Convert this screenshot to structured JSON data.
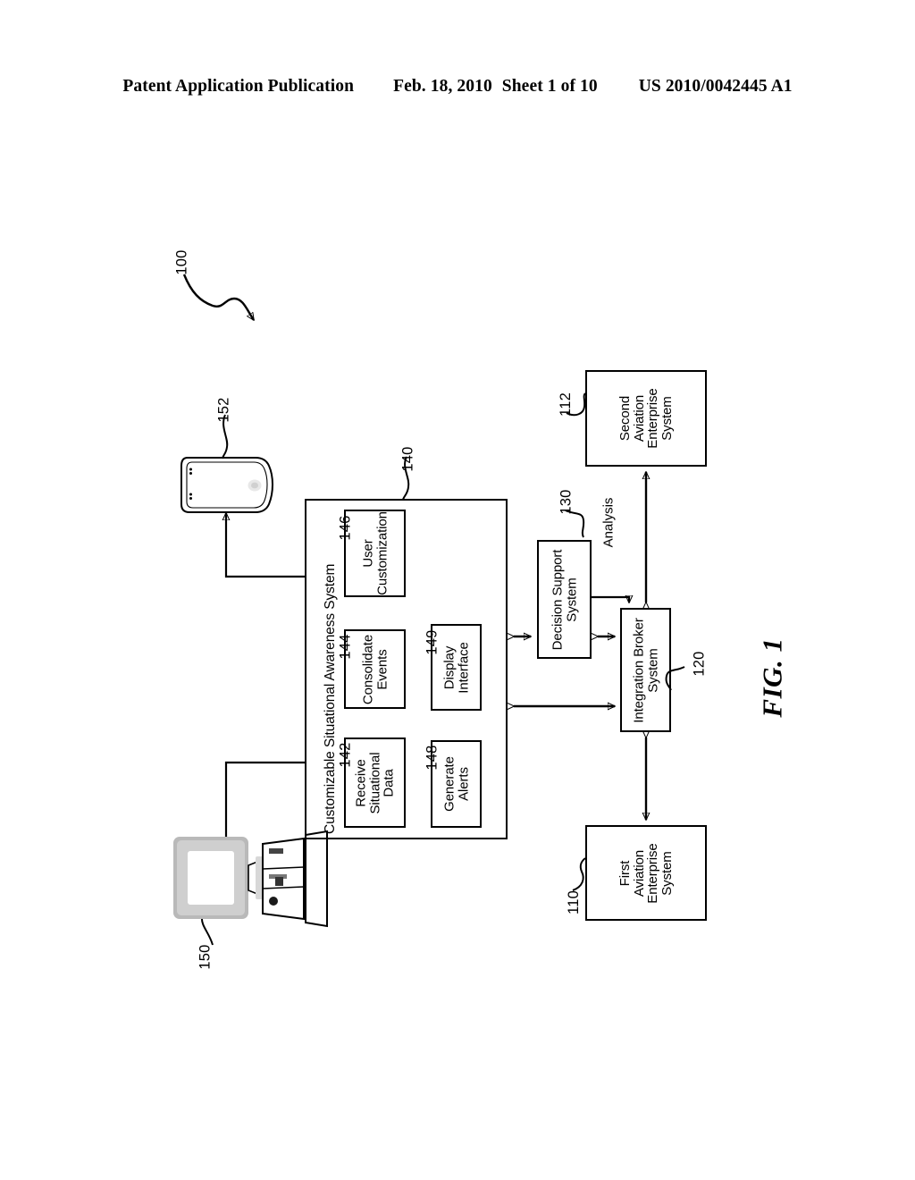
{
  "header": {
    "publication": "Patent Application Publication",
    "date": "Feb. 18, 2010",
    "sheet": "Sheet 1 of 10",
    "number": "US 2010/0042445 A1"
  },
  "figure": {
    "caption": "FIG. 1",
    "system_ref": "100"
  },
  "diagram": {
    "outer_system": {
      "title": "Customizable Situational Awareness System",
      "ref": "140",
      "modules": [
        {
          "ref": "142",
          "label": "Receive\nSituational\nData",
          "name": "receive-situational-data"
        },
        {
          "ref": "144",
          "label": "Consolidate\nEvents",
          "name": "consolidate-events"
        },
        {
          "ref": "146",
          "label": "User\nCustomization",
          "name": "user-customization"
        },
        {
          "ref": "148",
          "label": "Generate\nAlerts",
          "name": "generate-alerts"
        },
        {
          "ref": "149",
          "label": "Display\nInterface",
          "name": "display-interface"
        }
      ]
    },
    "blocks": [
      {
        "ref": "110",
        "label": "First\nAviation\nEnterprise\nSystem",
        "name": "first-aviation-enterprise-system"
      },
      {
        "ref": "112",
        "label": "Second\nAviation\nEnterprise\nSystem",
        "name": "second-aviation-enterprise-system"
      },
      {
        "ref": "120",
        "label": "Integration Broker\nSystem",
        "name": "integration-broker-system"
      },
      {
        "ref": "130",
        "label": "Decision Support\nSystem",
        "name": "decision-support-system"
      }
    ],
    "edge_labels": [
      {
        "label": "Analysis",
        "name": "analysis-edge-label"
      }
    ],
    "devices": [
      {
        "ref": "150",
        "name": "desktop-computer",
        "kind": "computer-workstation"
      },
      {
        "ref": "152",
        "name": "handheld-pda",
        "kind": "pda-device"
      }
    ]
  }
}
